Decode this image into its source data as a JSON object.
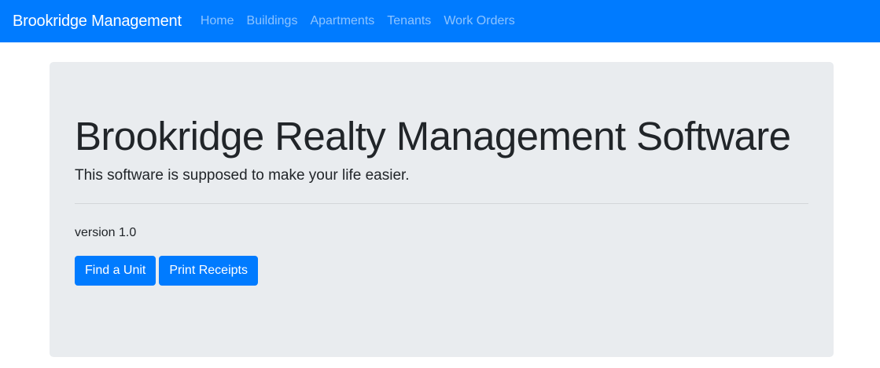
{
  "navbar": {
    "brand": "Brookridge Management",
    "items": [
      {
        "label": "Home"
      },
      {
        "label": "Buildings"
      },
      {
        "label": "Apartments"
      },
      {
        "label": "Tenants"
      },
      {
        "label": "Work Orders"
      }
    ],
    "background_color": "#007bff"
  },
  "hero": {
    "title": "Brookridge Realty Management Software",
    "lead": "This software is supposed to make your life easier.",
    "version": "version 1.0",
    "buttons": [
      {
        "label": "Find a Unit"
      },
      {
        "label": "Print Receipts"
      }
    ],
    "background_color": "#e9ecef"
  }
}
